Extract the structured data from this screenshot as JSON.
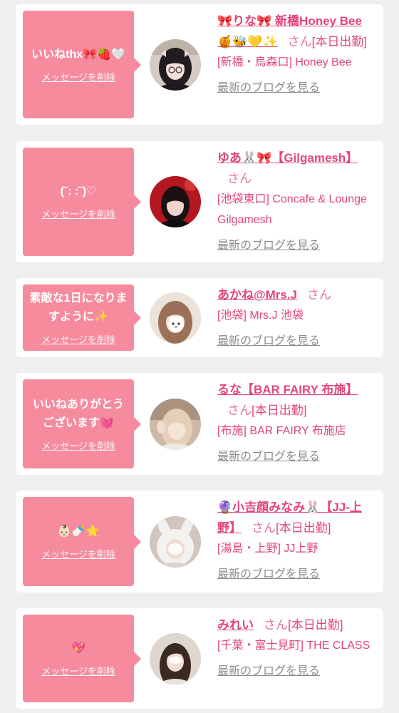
{
  "theme": {
    "page_bg": "#efefef",
    "card_bg": "#ffffff",
    "bubble": "#f68b9e",
    "accent": "#e2457a",
    "honorific": "#e6728f",
    "muted": "#8c8c8c"
  },
  "cards": [
    {
      "message": "いいねthx🎀🍓🤍",
      "delete_label": "メッセージを削除",
      "name": "🎀りな🎀 新橋Honey Bee 🍯🐝💛✨",
      "honorific": "さん",
      "status": "[本日出勤]",
      "location": "[新橋・烏森口] Honey Bee",
      "blog_label": "最新のブログを見る"
    },
    {
      "message": "(˘: :˘)♡",
      "delete_label": "メッセージを削除",
      "name": "ゆあ🐰🎀【Gilgamesh】",
      "honorific": "さん",
      "location": "[池袋東口] Concafe & Lounge Gilgamesh",
      "blog_label": "最新のブログを見る"
    },
    {
      "message": "素敵な1日になりますように✨",
      "delete_label": "メッセージを削除",
      "name": "あかね@Mrs.J",
      "honorific": "さん",
      "location": "[池袋] Mrs.J 池袋",
      "blog_label": "最新のブログを見る"
    },
    {
      "message": "いいねありがとうございます💓",
      "delete_label": "メッセージを削除",
      "name": "るな【BAR FAIRY 布施】",
      "honorific": "さん",
      "status": "[本日出勤]",
      "location": "[布施] BAR FAIRY 布施店",
      "blog_label": "最新のブログを見る"
    },
    {
      "message": "👶🏻🍼⭐",
      "delete_label": "メッセージを削除",
      "name": "🔮小吉顔みなみ🐰【JJ-上野】",
      "honorific": "さん",
      "status": "[本日出勤]",
      "location": "[湯島・上野] JJ上野",
      "blog_label": "最新のブログを見る"
    },
    {
      "message": "💖",
      "delete_label": "メッセージを削除",
      "name": "みれい",
      "honorific": "さん",
      "status": "[本日出勤]",
      "location": "[千葉・富士見町] THE CLASS",
      "blog_label": "最新のブログを見る"
    }
  ]
}
